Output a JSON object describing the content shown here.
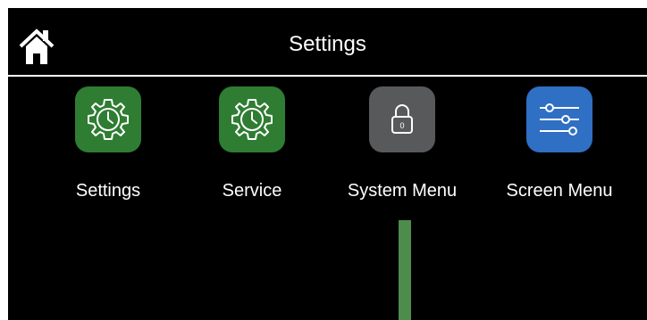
{
  "header": {
    "title": "Settings",
    "home_icon": "home-icon"
  },
  "tiles": [
    {
      "label": "Settings",
      "icon": "gear-clock-icon",
      "color": "#2f7d32"
    },
    {
      "label": "Service",
      "icon": "gear-clock-icon",
      "color": "#2f7d32"
    },
    {
      "label": "System Menu",
      "icon": "lock-icon",
      "color": "#58595b"
    },
    {
      "label": "Screen Menu",
      "icon": "sliders-icon",
      "color": "#2f6fc4"
    }
  ],
  "level_bar": {
    "color": "#4e8c4c"
  }
}
